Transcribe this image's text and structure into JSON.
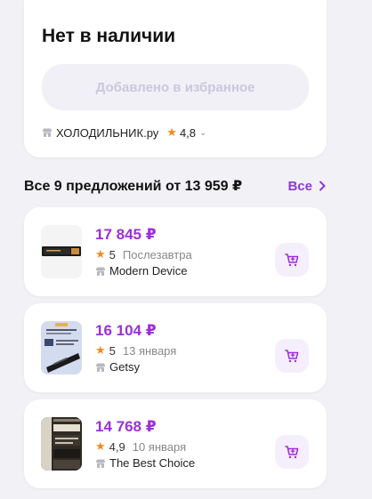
{
  "product": {
    "status_title": "Нет в наличии",
    "favorite_button_label": "Добавлено в избранное",
    "shop_name": "ХОЛОДИЛЬНИК.ру",
    "shop_rating": "4,8"
  },
  "offers": {
    "header_title": "Все 9 предложений от 13 959 ₽",
    "all_link_label": "Все",
    "items": [
      {
        "price": "17 845 ₽",
        "rating": "5",
        "delivery": "Послезавтра",
        "seller": "Modern Device"
      },
      {
        "price": "16 104 ₽",
        "rating": "5",
        "delivery": "13 января",
        "seller": "Getsy"
      },
      {
        "price": "14 768 ₽",
        "rating": "4,9",
        "delivery": "10 января",
        "seller": "The Best Choice"
      }
    ]
  },
  "colors": {
    "accent": "#9c2fd9",
    "link": "#8e3ad6",
    "star": "#f38b1f",
    "favorite_bg": "#f1f0f7"
  },
  "icons": [
    "shop-icon",
    "star-icon",
    "chevron-down-icon",
    "chevron-right-icon",
    "cart-icon"
  ]
}
